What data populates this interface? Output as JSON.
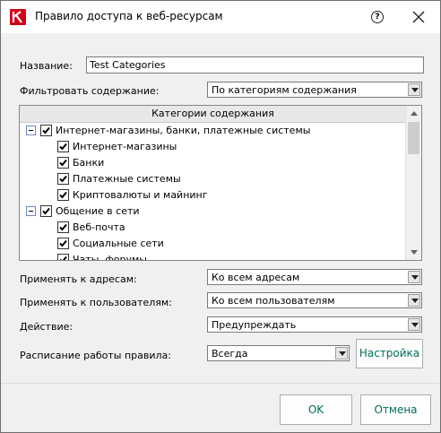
{
  "window": {
    "title": "Правило доступа к веб-ресурсам"
  },
  "fields": {
    "name_label": "Название:",
    "name_value": "Test Categories",
    "filter_label": "Фильтровать содержание:",
    "filter_value": "По категориям содержания",
    "apply_addresses_label": "Применять к адресам:",
    "apply_addresses_value": "Ко всем адресам",
    "apply_users_label": "Применять к пользователям:",
    "apply_users_value": "Ко всем пользователям",
    "action_label": "Действие:",
    "action_value": "Предупреждать",
    "schedule_label": "Расписание работы правила:",
    "schedule_value": "Всегда",
    "settings_button": "Настройка"
  },
  "categories": {
    "header": "Категории содержания",
    "groups": [
      {
        "label": "Интернет-магазины, банки, платежные системы",
        "checked": true,
        "expanded": true,
        "items": [
          {
            "label": "Интернет-магазины",
            "checked": true
          },
          {
            "label": "Банки",
            "checked": true
          },
          {
            "label": "Платежные системы",
            "checked": true
          },
          {
            "label": "Криптовалюты и майнинг",
            "checked": true
          }
        ]
      },
      {
        "label": "Общение в сети",
        "checked": true,
        "expanded": true,
        "items": [
          {
            "label": "Веб-почта",
            "checked": true
          },
          {
            "label": "Социальные сети",
            "checked": true
          },
          {
            "label": "Чаты, форумы",
            "checked": true
          }
        ]
      }
    ]
  },
  "footer": {
    "ok": "OK",
    "cancel": "Отмена"
  },
  "colors": {
    "accent": "#006d5b",
    "brand": "#d0021b"
  }
}
